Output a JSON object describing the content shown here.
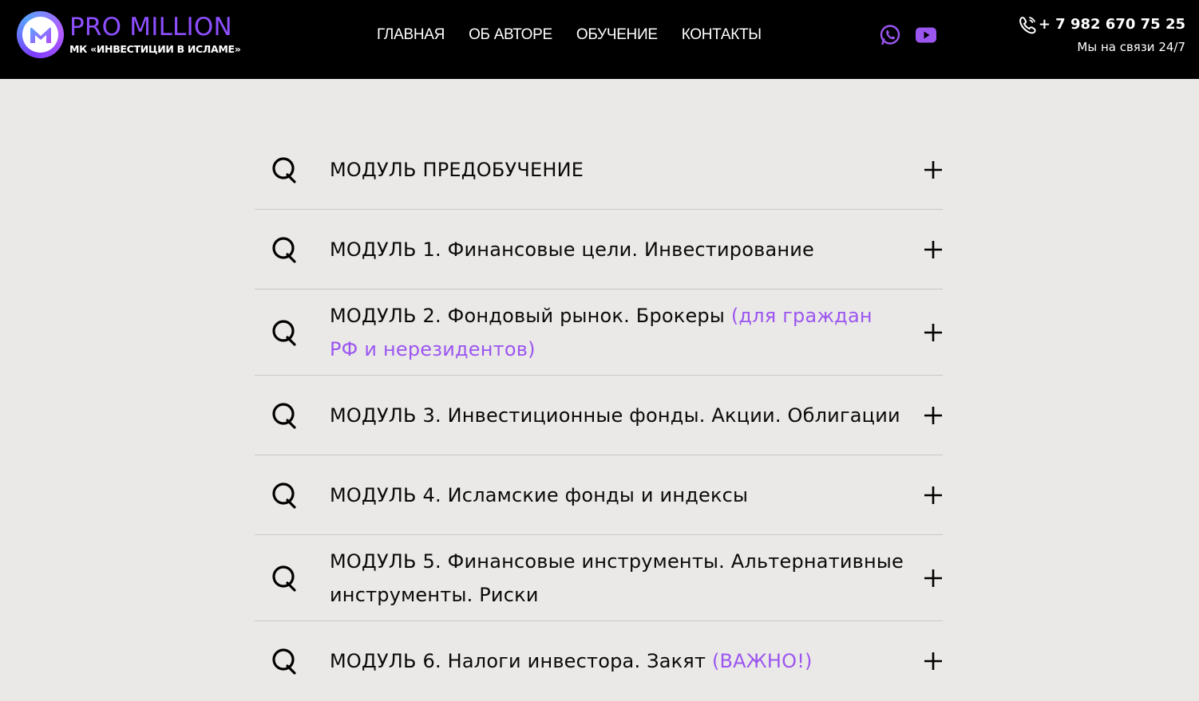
{
  "header": {
    "logo_title": "PRO MILLION",
    "logo_subtitle": "МК «ИНВЕСТИЦИИ В ИСЛАМЕ»",
    "logo_icon": "m-logo-icon",
    "nav": [
      {
        "label": "ГЛАВНАЯ"
      },
      {
        "label": "ОБ АВТОРЕ"
      },
      {
        "label": "ОБУЧЕНИЕ"
      },
      {
        "label": "КОНТАКТЫ"
      }
    ],
    "social": [
      {
        "icon": "whatsapp-icon"
      },
      {
        "icon": "youtube-icon"
      }
    ],
    "phone": "+ 7 982 670 75 25",
    "phone_note": "Мы на связи 24/7"
  },
  "colors": {
    "header_bg": "#000000",
    "accent": "#9b56f0",
    "page_bg": "#ebe9e7"
  },
  "faq": {
    "items": [
      {
        "main": "МОДУЛЬ  ПРЕДОБУЧЕНИЕ",
        "accent": ""
      },
      {
        "main": "МОДУЛЬ 1. Финансовые цели. Инвестирование",
        "accent": ""
      },
      {
        "main": "МОДУЛЬ 2. Фондовый рынок. Брокеры ",
        "accent": "(для граждан РФ и нерезидентов)"
      },
      {
        "main": "МОДУЛЬ 3. Инвестиционные фонды. Акции. Облигации",
        "accent": ""
      },
      {
        "main": "МОДУЛЬ 4. Исламские фонды  и индексы",
        "accent": ""
      },
      {
        "main": "МОДУЛЬ 5. Финансовые инструменты. Альтернативные инструменты. Риски",
        "accent": ""
      },
      {
        "main": "МОДУЛЬ 6. Налоги инвестора. Закят ",
        "accent": "(ВАЖНО!)"
      }
    ]
  }
}
